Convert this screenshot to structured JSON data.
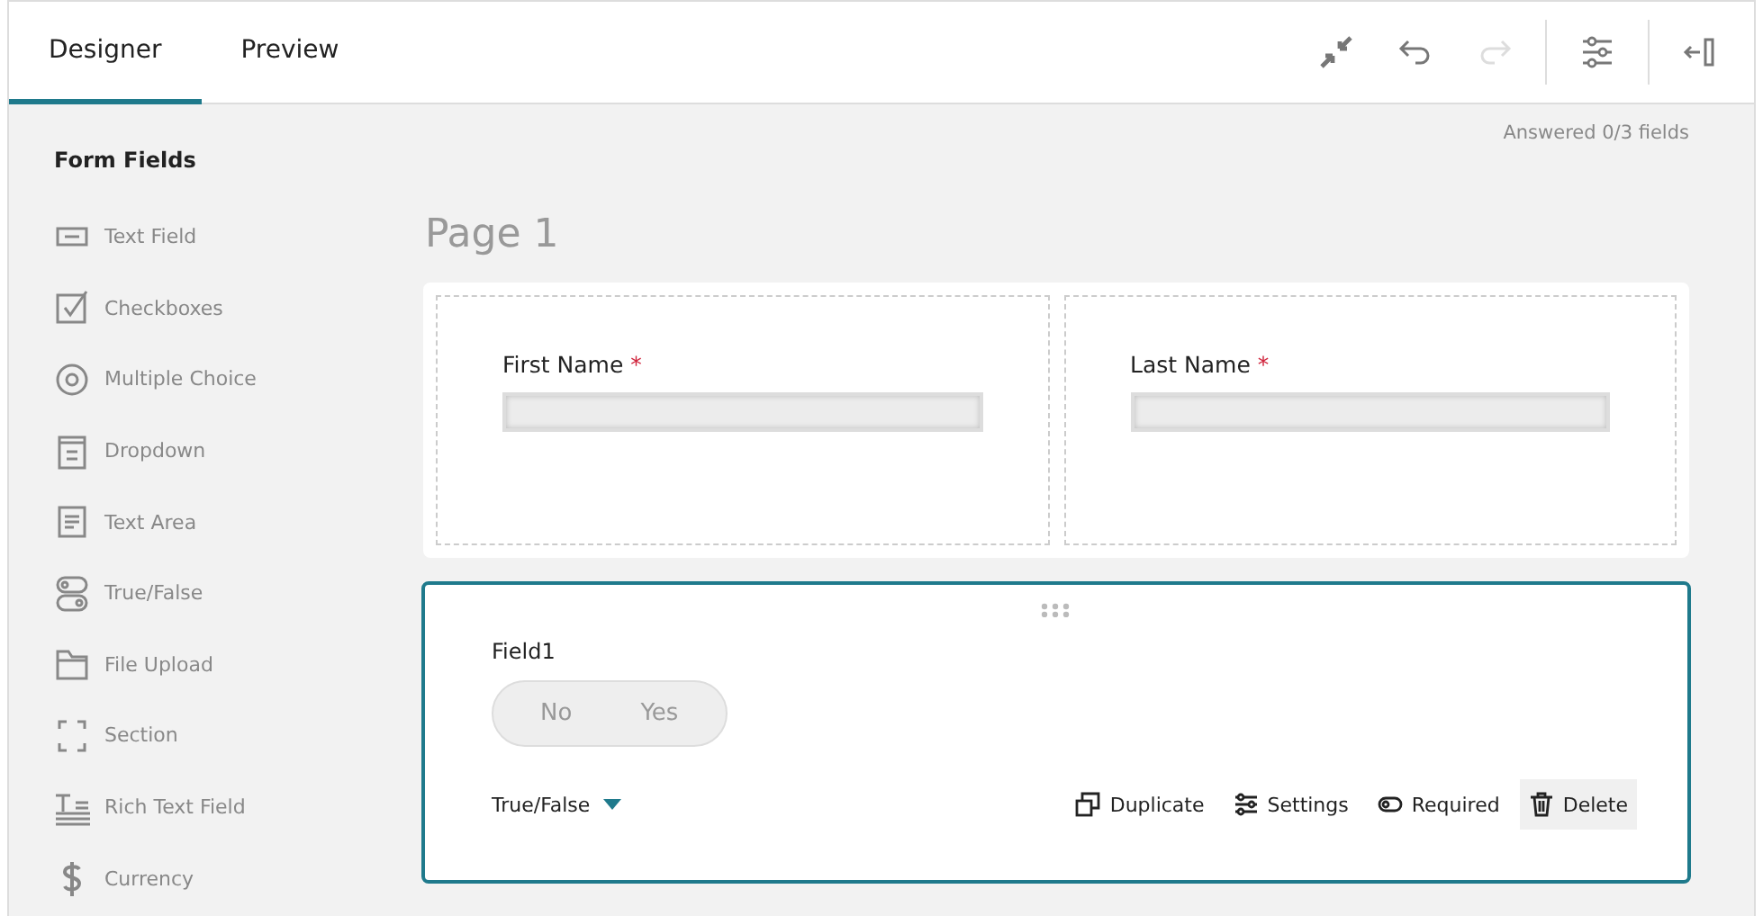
{
  "tabs": [
    {
      "label": "Designer",
      "selected": true
    },
    {
      "label": "Preview",
      "selected": false
    }
  ],
  "toolbar": [
    {
      "kind": "compress",
      "disabled": false
    },
    {
      "kind": "undo",
      "disabled": false
    },
    {
      "kind": "redo",
      "disabled": true
    },
    {
      "kind": "settings",
      "disabled": false
    },
    {
      "kind": "collapse",
      "disabled": false
    }
  ],
  "sidebar": {
    "title": "Form Fields",
    "items": [
      {
        "kind": "text",
        "label": "Text Field"
      },
      {
        "kind": "checkbox",
        "label": "Checkboxes"
      },
      {
        "kind": "radio",
        "label": "Multiple Choice"
      },
      {
        "kind": "dropdown",
        "label": "Dropdown"
      },
      {
        "kind": "textarea",
        "label": "Text Area"
      },
      {
        "kind": "toggle",
        "label": "True/False"
      },
      {
        "kind": "folder",
        "label": "File Upload"
      },
      {
        "kind": "section",
        "label": "Section"
      },
      {
        "kind": "rich",
        "label": "Rich Text Field"
      },
      {
        "kind": "currency",
        "label": "Currency"
      }
    ]
  },
  "progress": "Answered 0/3 fields",
  "page_title": "Page 1",
  "name_fields": [
    {
      "label": "First Name",
      "required_mark": "*"
    },
    {
      "label": "Last Name",
      "required_mark": "*"
    }
  ],
  "selected_field": {
    "label": "Field1",
    "options": [
      "No",
      "Yes"
    ],
    "type_label": "True/False",
    "actions": [
      {
        "kind": "duplicate",
        "label": "Duplicate",
        "highlighted": false
      },
      {
        "kind": "settings",
        "label": "Settings",
        "highlighted": false
      },
      {
        "kind": "required",
        "label": "Required",
        "highlighted": false
      },
      {
        "kind": "delete",
        "label": "Delete",
        "highlighted": true
      }
    ]
  }
}
